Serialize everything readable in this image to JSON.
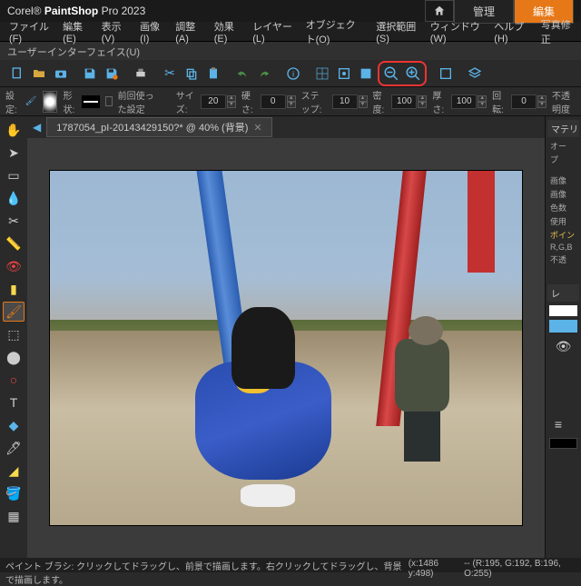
{
  "title": {
    "brand_prefix": "Corel®",
    "brand_main": "PaintShop",
    "brand_suffix": "Pro 2023"
  },
  "header_tabs": {
    "manage": "管理",
    "edit": "編集"
  },
  "menu": {
    "file": "ファイル(F)",
    "edit": "編集(E)",
    "view": "表示(V)",
    "image": "画像(I)",
    "adjust": "調整(A)",
    "effects": "効果(E)",
    "layers": "レイヤー(L)",
    "objects": "オブジェクト(O)",
    "selections": "選択範囲(S)",
    "window": "ウィンドウ(W)",
    "help": "ヘルプ(H)",
    "photo_fix": "写真修正"
  },
  "subtitle": "ユーザーインターフェイス(U)",
  "options": {
    "settings_label": "設定:",
    "shape_label": "形状:",
    "last_used_label": "前回使った設定",
    "size_label": "サイズ:",
    "size_value": "20",
    "hardness_label": "硬さ:",
    "hardness_value": "0",
    "step_label": "ステップ:",
    "step_value": "10",
    "density_label": "密度:",
    "density_value": "100",
    "thickness_label": "厚さ:",
    "thickness_value": "100",
    "rotation_label": "回転:",
    "rotation_value": "0",
    "opacity_label": "不透明度"
  },
  "document": {
    "tab_title": "1787054_pI-20143429150?* @ 40% (背景)"
  },
  "right_panel": {
    "materials": "マテリアル",
    "auto": "オー",
    "pro": "プ",
    "info_image1": "画像",
    "info_image2": "画像",
    "info_colors": "色数",
    "info_used": "使用",
    "info_point": "ポイン",
    "info_rgb": "R,G,B",
    "info_opacity": "不透",
    "layers": "レ"
  },
  "status": {
    "hint": "ペイント ブラシ: クリックしてドラッグし、前景で描画します。右クリックしてドラッグし、背景で描画します。",
    "coords": "(x:1486 y:498)",
    "color": "-- (R:195, G:192, B:196, O:255)"
  }
}
